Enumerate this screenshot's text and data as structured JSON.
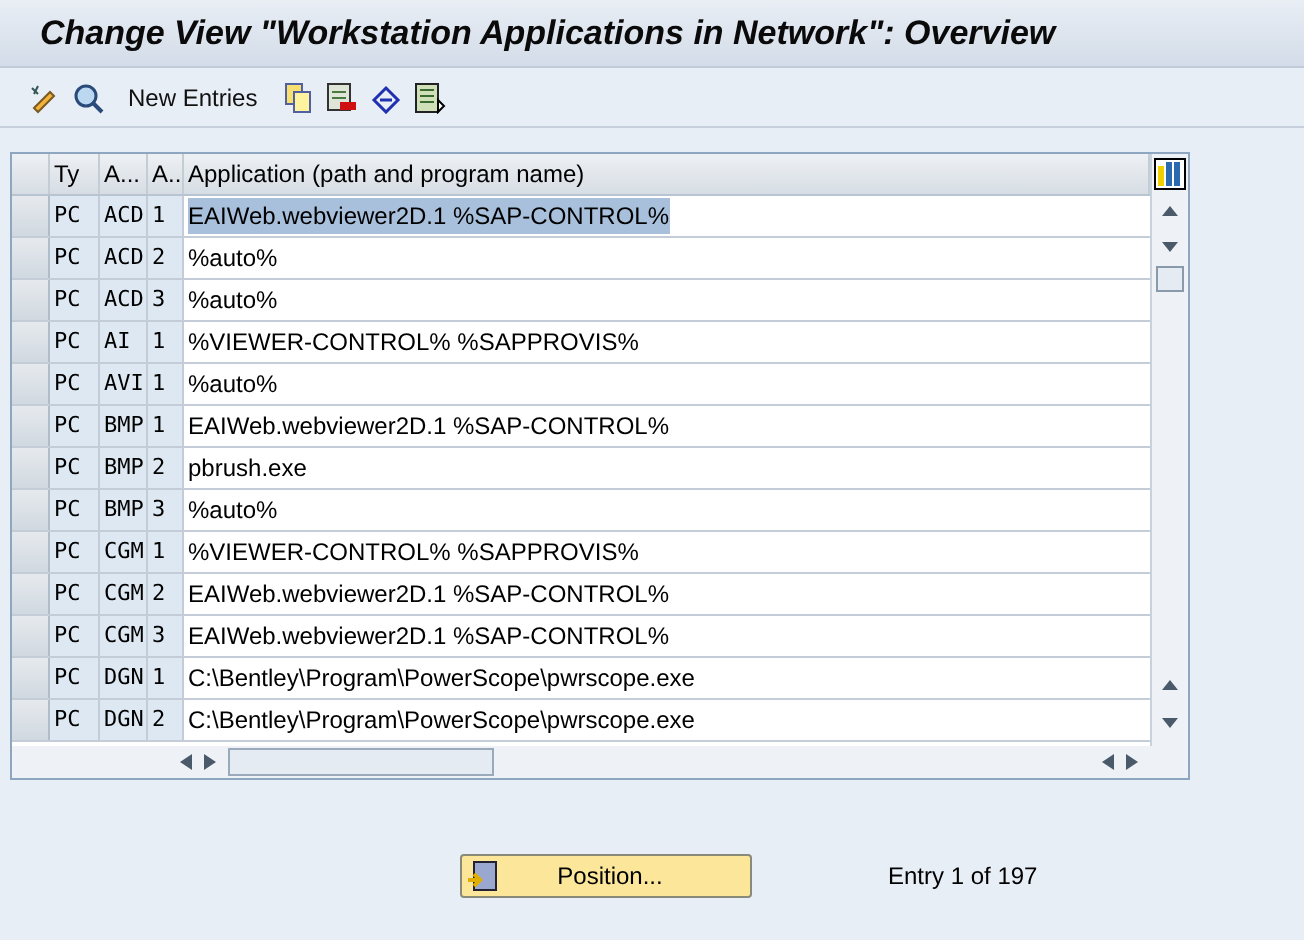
{
  "window": {
    "title": "Change View \"Workstation Applications in Network\": Overview"
  },
  "toolbar": {
    "new_entries": "New Entries"
  },
  "table": {
    "columns": [
      "Ty",
      "A...",
      "A..",
      "Application (path and program name)"
    ],
    "rows": [
      {
        "cells": [
          "PC",
          "ACD",
          "1",
          "EAIWeb.webviewer2D.1 %SAP-CONTROL%"
        ],
        "selected": true
      },
      {
        "cells": [
          "PC",
          "ACD",
          "2",
          "%auto%"
        ],
        "selected": false
      },
      {
        "cells": [
          "PC",
          "ACD",
          "3",
          "%auto%"
        ],
        "selected": false
      },
      {
        "cells": [
          "PC",
          "AI",
          "1",
          "%VIEWER-CONTROL% %SAPPROVIS%"
        ],
        "selected": false
      },
      {
        "cells": [
          "PC",
          "AVI",
          "1",
          "%auto%"
        ],
        "selected": false
      },
      {
        "cells": [
          "PC",
          "BMP",
          "1",
          "EAIWeb.webviewer2D.1 %SAP-CONTROL%"
        ],
        "selected": false
      },
      {
        "cells": [
          "PC",
          "BMP",
          "2",
          "pbrush.exe"
        ],
        "selected": false
      },
      {
        "cells": [
          "PC",
          "BMP",
          "3",
          "%auto%"
        ],
        "selected": false
      },
      {
        "cells": [
          "PC",
          "CGM",
          "1",
          "%VIEWER-CONTROL% %SAPPROVIS%"
        ],
        "selected": false
      },
      {
        "cells": [
          "PC",
          "CGM",
          "2",
          "EAIWeb.webviewer2D.1 %SAP-CONTROL%"
        ],
        "selected": false
      },
      {
        "cells": [
          "PC",
          "CGM",
          "3",
          "EAIWeb.webviewer2D.1 %SAP-CONTROL%"
        ],
        "selected": false
      },
      {
        "cells": [
          "PC",
          "DGN",
          "1",
          "C:\\Bentley\\Program\\PowerScope\\pwrscope.exe"
        ],
        "selected": false
      },
      {
        "cells": [
          "PC",
          "DGN",
          "2",
          "C:\\Bentley\\Program\\PowerScope\\pwrscope.exe"
        ],
        "selected": false
      }
    ]
  },
  "footer": {
    "position_button": "Position...",
    "entry_count": "Entry 1 of 197"
  }
}
